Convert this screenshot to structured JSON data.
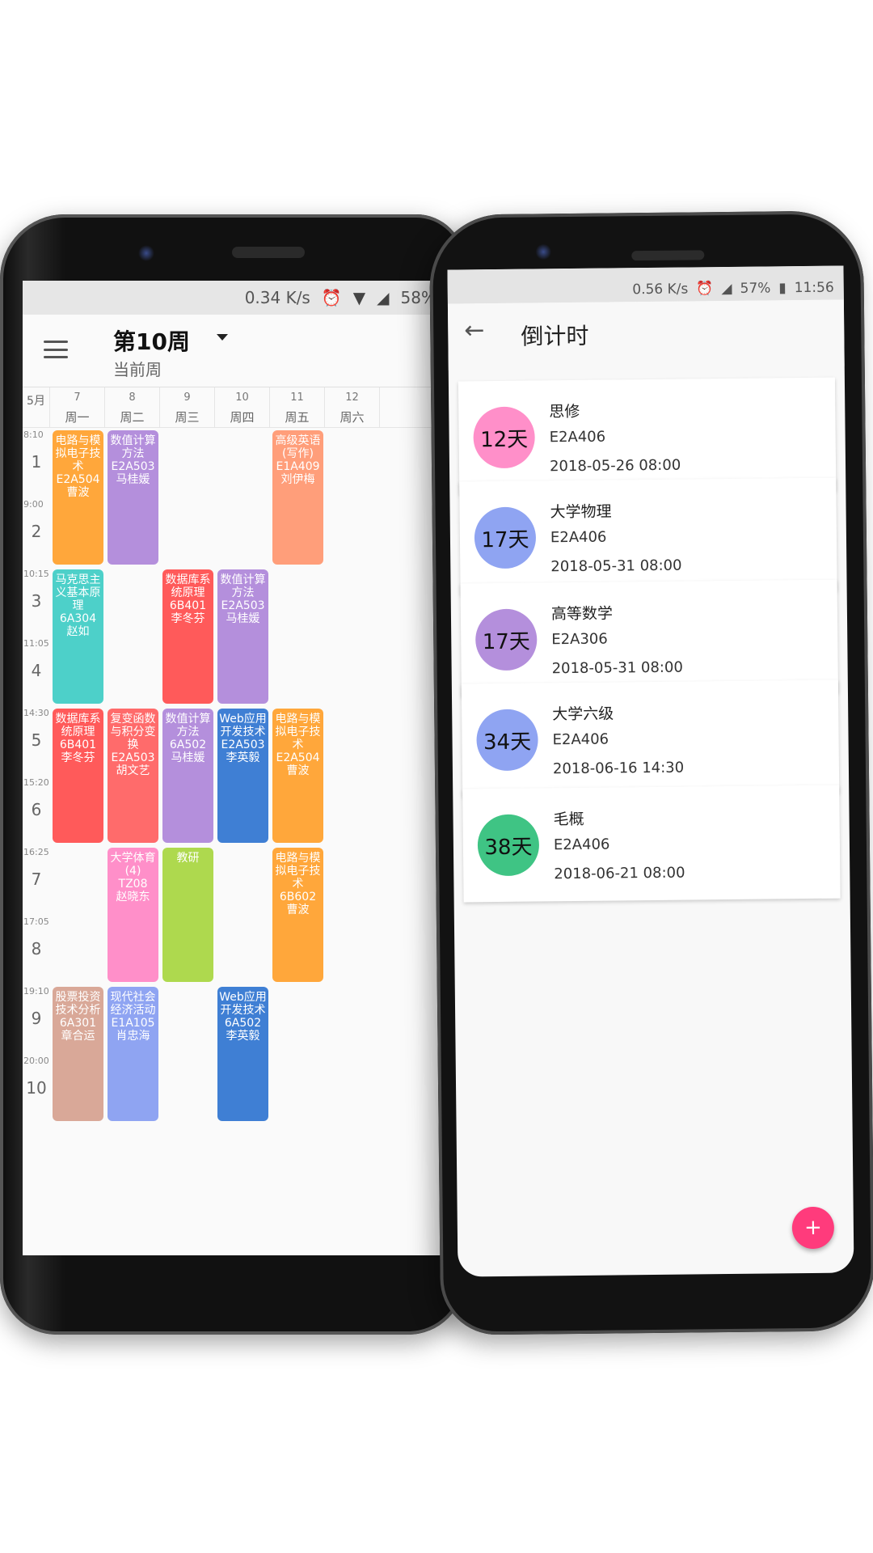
{
  "schedule": {
    "status": {
      "speed": "0.34 K/s",
      "battery": "58%"
    },
    "appbar": {
      "week": "第10周",
      "sub": "当前周"
    },
    "header": {
      "month": "5月",
      "days": [
        {
          "date": "7",
          "weekday": "周一"
        },
        {
          "date": "8",
          "weekday": "周二"
        },
        {
          "date": "9",
          "weekday": "周三"
        },
        {
          "date": "10",
          "weekday": "周四"
        },
        {
          "date": "11",
          "weekday": "周五"
        },
        {
          "date": "12",
          "weekday": "周六"
        }
      ]
    },
    "slots": [
      {
        "time": "8:10",
        "num": "1"
      },
      {
        "time": "9:00",
        "num": "2"
      },
      {
        "time": "10:15",
        "num": "3"
      },
      {
        "time": "11:05",
        "num": "4"
      },
      {
        "time": "14:30",
        "num": "5"
      },
      {
        "time": "15:20",
        "num": "6"
      },
      {
        "time": "16:25",
        "num": "7"
      },
      {
        "time": "17:05",
        "num": "8"
      },
      {
        "time": "19:10",
        "num": "9"
      },
      {
        "time": "20:00",
        "num": "10"
      }
    ],
    "courses": [
      {
        "day": 0,
        "start": 0,
        "span": 2,
        "text": "电路与模拟电子技术\nE2A504\n曹波",
        "color": "#ffa73b"
      },
      {
        "day": 1,
        "start": 0,
        "span": 2,
        "text": "数值计算方法\nE2A503\n马桂媛",
        "color": "#b48fdc"
      },
      {
        "day": 4,
        "start": 0,
        "span": 2,
        "text": "高级英语(写作)\nE1A409\n刘伊梅",
        "color": "#ff9e7a"
      },
      {
        "day": 0,
        "start": 2,
        "span": 2,
        "text": "马克思主义基本原理\n6A304\n赵如",
        "color": "#4dd0c9"
      },
      {
        "day": 2,
        "start": 2,
        "span": 2,
        "text": "数据库系统原理\n6B401\n李冬芬",
        "color": "#ff5a5a"
      },
      {
        "day": 3,
        "start": 2,
        "span": 2,
        "text": "数值计算方法\nE2A503\n马桂媛",
        "color": "#b48fdc"
      },
      {
        "day": 0,
        "start": 4,
        "span": 2,
        "text": "数据库系统原理\n6B401\n李冬芬",
        "color": "#ff5a5a"
      },
      {
        "day": 1,
        "start": 4,
        "span": 2,
        "text": "复变函数与积分变换\nE2A503\n胡文艺",
        "color": "#ff6b6b"
      },
      {
        "day": 2,
        "start": 4,
        "span": 2,
        "text": "数值计算方法\n6A502\n马桂媛",
        "color": "#b48fdc"
      },
      {
        "day": 3,
        "start": 4,
        "span": 2,
        "text": "Web应用开发技术\nE2A503\n李英毅",
        "color": "#3f7fd4"
      },
      {
        "day": 4,
        "start": 4,
        "span": 2,
        "text": "电路与模拟电子技术\nE2A504\n曹波",
        "color": "#ffa73b"
      },
      {
        "day": 1,
        "start": 6,
        "span": 2,
        "text": "大学体育(4)\nTZ08\n赵晓东",
        "color": "#ff8fc9"
      },
      {
        "day": 2,
        "start": 6,
        "span": 2,
        "text": "教研",
        "color": "#aed94e"
      },
      {
        "day": 4,
        "start": 6,
        "span": 2,
        "text": "电路与模拟电子技术\n6B602\n曹波",
        "color": "#ffa73b"
      },
      {
        "day": 0,
        "start": 8,
        "span": 2,
        "text": "股票投资技术分析\n6A301\n章合运",
        "color": "#d9a898"
      },
      {
        "day": 1,
        "start": 8,
        "span": 2,
        "text": "现代社会经济活动\nE1A105\n肖忠海",
        "color": "#8fa4f2"
      },
      {
        "day": 3,
        "start": 8,
        "span": 2,
        "text": "Web应用开发技术\n6A502\n李英毅",
        "color": "#3f7fd4"
      }
    ]
  },
  "countdown": {
    "status": {
      "speed": "0.56 K/s",
      "battery": "57%",
      "clock": "11:56"
    },
    "title": "倒计时",
    "items": [
      {
        "days": "12天",
        "name": "思修",
        "room": "E2A406",
        "time": "2018-05-26 08:00",
        "color": "#ff8fc9"
      },
      {
        "days": "17天",
        "name": "大学物理",
        "room": "E2A406",
        "time": "2018-05-31 08:00",
        "color": "#8fa4f2"
      },
      {
        "days": "17天",
        "name": "高等数学",
        "room": "E2A306",
        "time": "2018-05-31 08:00",
        "color": "#b48fdc"
      },
      {
        "days": "34天",
        "name": "大学六级",
        "room": "E2A406",
        "time": "2018-06-16 14:30",
        "color": "#8fa4f2"
      },
      {
        "days": "38天",
        "name": "毛概",
        "room": "E2A406",
        "time": "2018-06-21 08:00",
        "color": "#3fc484"
      }
    ],
    "fab": "+"
  }
}
